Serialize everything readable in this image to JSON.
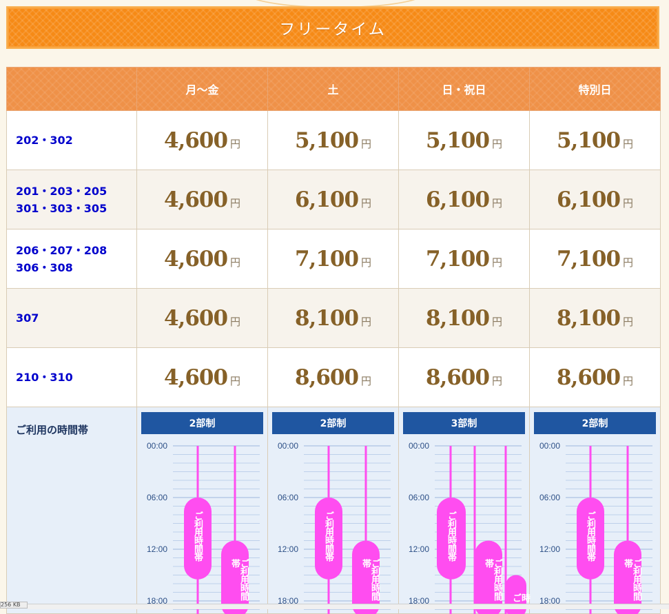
{
  "title": "フリータイム",
  "headers": [
    "",
    "月～金",
    "土",
    "日・祝日",
    "特別日"
  ],
  "yen": "円",
  "rows": [
    {
      "rooms": [
        "202・302"
      ],
      "prices": [
        "4,600",
        "5,100",
        "5,100",
        "5,100"
      ]
    },
    {
      "rooms": [
        "201・203・205",
        "301・303・305"
      ],
      "prices": [
        "4,600",
        "6,100",
        "6,100",
        "6,100"
      ]
    },
    {
      "rooms": [
        "206・207・208",
        "306・308"
      ],
      "prices": [
        "4,600",
        "7,100",
        "7,100",
        "7,100"
      ]
    },
    {
      "rooms": [
        "307"
      ],
      "prices": [
        "4,600",
        "8,100",
        "8,100",
        "8,100"
      ]
    },
    {
      "rooms": [
        "210・310"
      ],
      "prices": [
        "4,600",
        "8,600",
        "8,600",
        "8,600"
      ]
    }
  ],
  "time_label": "ご利用の時間帯",
  "time_ticks": [
    "00:00",
    "06:00",
    "12:00",
    "18:00"
  ],
  "pill_label": "ご利用時間帯",
  "pill_label_short": "時ご",
  "timezones": [
    {
      "system": "2部制",
      "slots": [
        {
          "start": 6,
          "end": 15.5
        },
        {
          "start": 11,
          "end": 20
        }
      ]
    },
    {
      "system": "2部制",
      "slots": [
        {
          "start": 6,
          "end": 15.5
        },
        {
          "start": 11,
          "end": 20
        }
      ]
    },
    {
      "system": "3部制",
      "slots": [
        {
          "start": 6,
          "end": 15.5
        },
        {
          "start": 11,
          "end": 20
        },
        {
          "start": 15,
          "end": 20
        }
      ]
    },
    {
      "system": "2部制",
      "slots": [
        {
          "start": 6,
          "end": 15.5
        },
        {
          "start": 11,
          "end": 20
        }
      ]
    }
  ],
  "colors": {
    "accent": "#f68a16",
    "header": "#ef9148",
    "room_text": "#0000cc",
    "price_text": "#866128",
    "system_bar": "#1f56a1",
    "pill": "#ff4df0",
    "timeline_bg": "#e7eff9"
  },
  "status_text": "256 KB"
}
